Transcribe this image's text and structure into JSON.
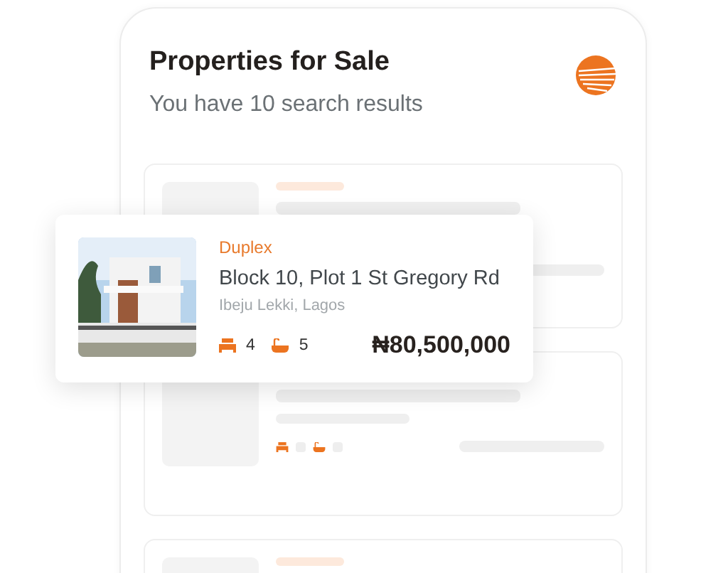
{
  "header": {
    "title": "Properties for Sale",
    "subtitle": "You have 10 search results"
  },
  "results": [
    {
      "kind": "skeleton_covered"
    },
    {
      "kind": "skeleton"
    },
    {
      "kind": "skeleton"
    }
  ],
  "featured_listing": {
    "type": "Duplex",
    "title": "Block 10, Plot 1 St Gregory Rd",
    "location": "Ibeju Lekki, Lagos",
    "bedrooms": "4",
    "bathrooms": "5",
    "price": "₦80,500,000"
  }
}
